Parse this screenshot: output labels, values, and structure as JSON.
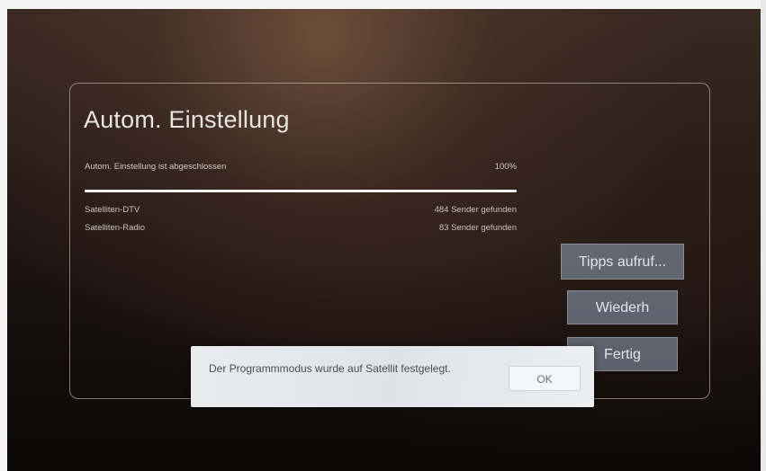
{
  "screen": {
    "title": "Autom. Einstellung",
    "status_text": "Autom. Einstellung ist abgeschlossen",
    "progress_label": "100%",
    "progress_fraction": 1.0
  },
  "results": [
    {
      "label": "Satelliten-DTV",
      "count": "484 Sender gefunden"
    },
    {
      "label": "Satelliten-Radio",
      "count": "83 Sender gefunden"
    }
  ],
  "buttons": {
    "tips": "Tipps aufruf...",
    "repeat": "Wiederh",
    "done": "Fertig"
  },
  "dialog": {
    "message": "Der Programmmodus wurde auf Satellit festgelegt.",
    "ok_label": "OK"
  }
}
